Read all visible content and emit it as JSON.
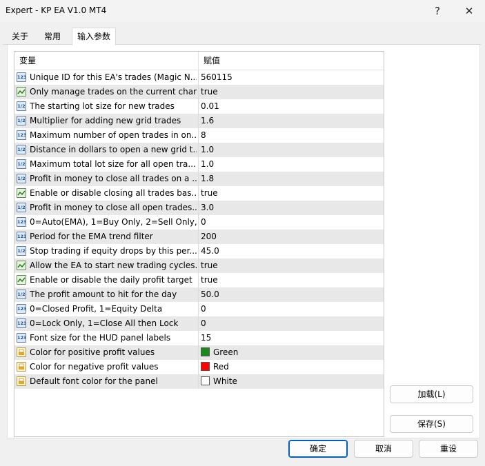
{
  "window": {
    "title": "Expert - KP EA V1.0 MT4",
    "help_label": "?",
    "close_label": "✕"
  },
  "tabs": [
    {
      "label": "关于"
    },
    {
      "label": "常用"
    },
    {
      "label": "输入参数"
    }
  ],
  "table": {
    "headers": {
      "variable": "变量",
      "value": "赋值"
    },
    "rows": [
      {
        "type": "int",
        "icon": "int-icon",
        "name": "Unique ID for this EA's trades (Magic N...",
        "value": "560115"
      },
      {
        "type": "bool",
        "icon": "bool-icon",
        "name": "Only manage trades on the current chart",
        "value": "true"
      },
      {
        "type": "double",
        "icon": "double-icon",
        "name": "The starting lot size for new trades",
        "value": "0.01"
      },
      {
        "type": "double",
        "icon": "double-icon",
        "name": "Multiplier for adding new grid trades",
        "value": "1.6"
      },
      {
        "type": "int",
        "icon": "int-icon",
        "name": "Maximum number of open trades in on...",
        "value": "8"
      },
      {
        "type": "double",
        "icon": "double-icon",
        "name": "Distance in dollars to open a new grid t...",
        "value": "1.0"
      },
      {
        "type": "double",
        "icon": "double-icon",
        "name": "Maximum total lot size for all open tra...",
        "value": "1.0"
      },
      {
        "type": "double",
        "icon": "double-icon",
        "name": "Profit in money to close all trades on a ...",
        "value": "1.8"
      },
      {
        "type": "bool",
        "icon": "bool-icon",
        "name": "Enable or disable closing all trades bas...",
        "value": "true"
      },
      {
        "type": "double",
        "icon": "double-icon",
        "name": "Profit in money to close all open trades...",
        "value": "3.0"
      },
      {
        "type": "int",
        "icon": "int-icon",
        "name": "0=Auto(EMA), 1=Buy Only, 2=Sell Only, ...",
        "value": "0"
      },
      {
        "type": "int",
        "icon": "int-icon",
        "name": "Period for the EMA trend filter",
        "value": "200"
      },
      {
        "type": "double",
        "icon": "double-icon",
        "name": "Stop trading if equity drops by this per...",
        "value": "45.0"
      },
      {
        "type": "bool",
        "icon": "bool-icon",
        "name": "Allow the EA to start new trading cycles...",
        "value": "true"
      },
      {
        "type": "bool",
        "icon": "bool-icon",
        "name": "Enable or disable the daily profit target",
        "value": "true"
      },
      {
        "type": "double",
        "icon": "double-icon",
        "name": "The profit amount to hit for the day",
        "value": "50.0"
      },
      {
        "type": "int",
        "icon": "int-icon",
        "name": "0=Closed Profit, 1=Equity Delta",
        "value": "0"
      },
      {
        "type": "int",
        "icon": "int-icon",
        "name": "0=Lock Only, 1=Close All then Lock",
        "value": "0"
      },
      {
        "type": "int",
        "icon": "int-icon",
        "name": "Font size for the HUD panel labels",
        "value": "15"
      },
      {
        "type": "color",
        "icon": "color-icon",
        "name": "Color for positive profit values",
        "value": "Green",
        "swatch": "#1a8a1a"
      },
      {
        "type": "color",
        "icon": "color-icon",
        "name": "Color for negative profit values",
        "value": "Red",
        "swatch": "#ff0000"
      },
      {
        "type": "color",
        "icon": "color-icon",
        "name": "Default font color for the panel",
        "value": "White",
        "swatch": "#ffffff"
      }
    ]
  },
  "icon_text": {
    "int": "123",
    "double": "1/2"
  },
  "buttons": {
    "load": "加载(L)",
    "save": "保存(S)",
    "ok": "确定",
    "cancel": "取消",
    "reset": "重设"
  }
}
